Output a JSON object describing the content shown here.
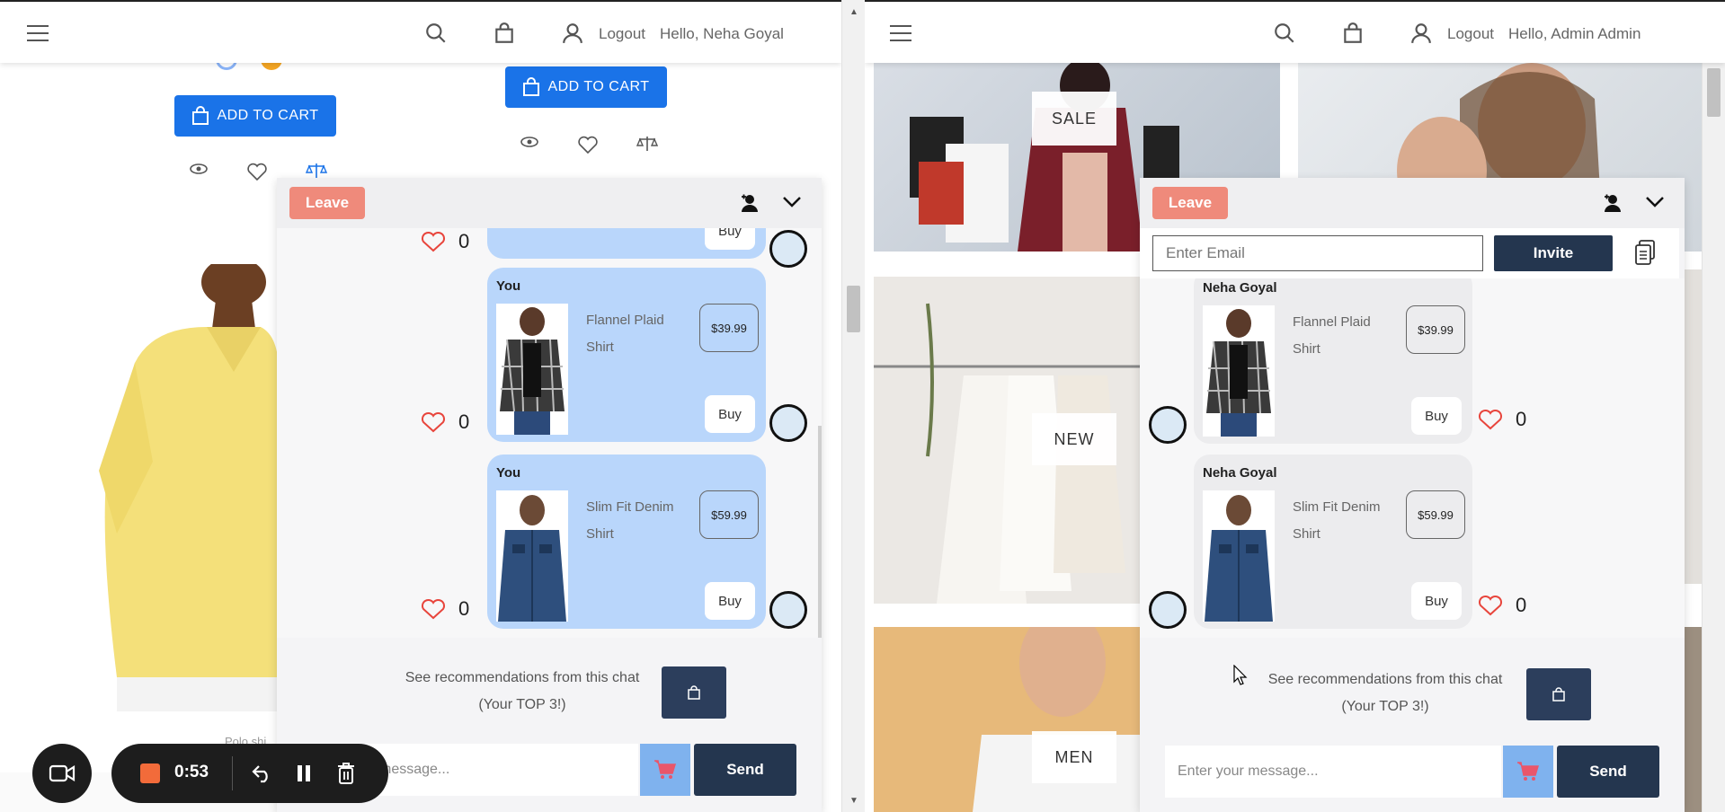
{
  "left": {
    "header": {
      "logout": "Logout",
      "greeting": "Hello, Neha Goyal"
    },
    "products": {
      "add_to_cart_1": "ADD TO CART",
      "add_to_cart_2": "ADD TO CART",
      "caption": "Polo shi",
      "caption2": "$ ..."
    },
    "chat": {
      "leave_label": "Leave",
      "top_buy": "Buy",
      "top_likes": "0",
      "messages": [
        {
          "sender": "You",
          "name": "Flannel Plaid Shirt",
          "price": "$39.99",
          "buy": "Buy",
          "likes": "0"
        },
        {
          "sender": "You",
          "name": "Slim Fit Denim Shirt",
          "price": "$59.99",
          "buy": "Buy",
          "likes": "0"
        }
      ],
      "reco_line1": "See recommendations from this chat",
      "reco_line2": "(Your TOP 3!)",
      "input_placeholder": "message...",
      "send_label": "Send"
    }
  },
  "right": {
    "header": {
      "logout": "Logout",
      "greeting": "Hello, Admin Admin"
    },
    "tiles": {
      "sale": "SALE",
      "new": "NEW",
      "men": "MEN"
    },
    "chat": {
      "leave_label": "Leave",
      "email_placeholder": "Enter Email",
      "invite_label": "Invite",
      "messages": [
        {
          "sender": "Neha Goyal",
          "name": "Flannel Plaid Shirt",
          "price": "$39.99",
          "buy": "Buy",
          "likes": "0"
        },
        {
          "sender": "Neha Goyal",
          "name": "Slim Fit Denim Shirt",
          "price": "$59.99",
          "buy": "Buy",
          "likes": "0"
        }
      ],
      "reco_line1": "See recommendations from this chat",
      "reco_line2": "(Your TOP 3!)",
      "input_placeholder": "Enter your message...",
      "send_label": "Send"
    }
  },
  "recorder": {
    "time": "0:53"
  },
  "colors": {
    "primary_blue": "#1a73e8",
    "leave": "#ef8a7b",
    "navy": "#24364f",
    "own_bubble": "#b9d6fb",
    "heart": "#e8453c"
  }
}
